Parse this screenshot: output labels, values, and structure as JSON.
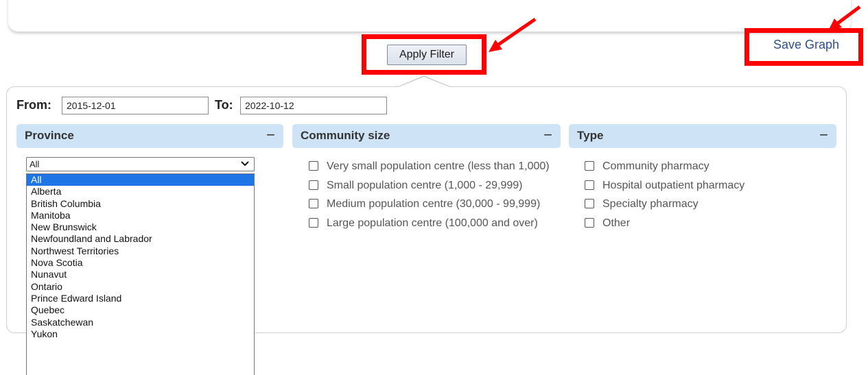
{
  "toolbar": {
    "apply_label": "Apply Filter",
    "save_label": "Save Graph"
  },
  "dates": {
    "from_label": "From:",
    "from_value": "2015-12-01",
    "to_label": "To:",
    "to_value": "2022-10-12"
  },
  "province": {
    "header": "Province",
    "collapse": "−",
    "selected": "All",
    "options": [
      "All",
      "Alberta",
      "British Columbia",
      "Manitoba",
      "New Brunswick",
      "Newfoundland and Labrador",
      "Northwest Territories",
      "Nova Scotia",
      "Nunavut",
      "Ontario",
      "Prince Edward Island",
      "Quebec",
      "Saskatchewan",
      "Yukon"
    ]
  },
  "community": {
    "header": "Community size",
    "collapse": "−",
    "items": [
      "Very small population centre (less than 1,000)",
      "Small population centre (1,000 - 29,999)",
      "Medium population centre (30,000 - 99,999)",
      "Large population centre (100,000 and over)"
    ]
  },
  "type": {
    "header": "Type",
    "collapse": "−",
    "items": [
      "Community pharmacy",
      "Hospital outpatient pharmacy",
      "Specialty pharmacy",
      "Other"
    ]
  },
  "colors": {
    "highlight": "#ff0000",
    "header_bg": "#cfe3f6",
    "selected_option": "#1e75e6",
    "link": "#2d4f88"
  }
}
